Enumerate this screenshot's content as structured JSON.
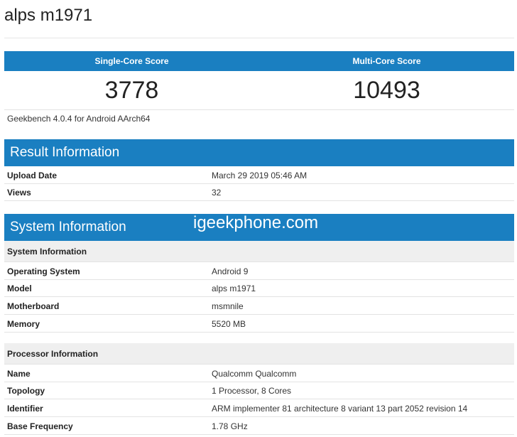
{
  "device": {
    "title": "alps m1971"
  },
  "scores": {
    "single_label": "Single-Core Score",
    "multi_label": "Multi-Core Score",
    "single_value": "3778",
    "multi_value": "10493",
    "version": "Geekbench 4.0.4 for Android AArch64"
  },
  "result": {
    "title": "Result Information",
    "rows": [
      {
        "key": "Upload Date",
        "value": "March 29 2019 05:46 AM"
      },
      {
        "key": "Views",
        "value": "32"
      }
    ]
  },
  "system": {
    "title": "System Information",
    "watermark": "igeekphone.com",
    "system_sub": "System Information",
    "system_rows": [
      {
        "key": "Operating System",
        "value": "Android 9"
      },
      {
        "key": "Model",
        "value": "alps m1971"
      },
      {
        "key": "Motherboard",
        "value": "msmnile"
      },
      {
        "key": "Memory",
        "value": "5520 MB"
      }
    ],
    "processor_sub": "Processor Information",
    "processor_rows": [
      {
        "key": "Name",
        "value": "Qualcomm Qualcomm"
      },
      {
        "key": "Topology",
        "value": "1 Processor, 8 Cores"
      },
      {
        "key": "Identifier",
        "value": "ARM implementer 81 architecture 8 variant 13 part 2052 revision 14"
      },
      {
        "key": "Base Frequency",
        "value": "1.78 GHz"
      }
    ]
  },
  "colors": {
    "header_blue": "#1a7fc1",
    "subheader_gray": "#efefef"
  }
}
